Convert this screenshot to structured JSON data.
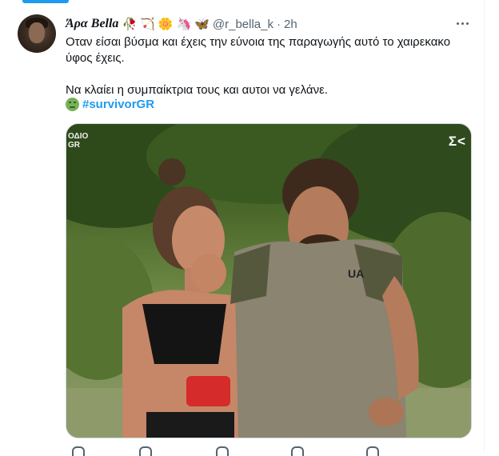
{
  "tweet": {
    "author_name": "Άρα Bella",
    "author_emojis": [
      "🥀",
      "🏹",
      "🌼",
      "🦄",
      "🦋"
    ],
    "handle": "@r_bella_k",
    "separator": "·",
    "time": "2h",
    "text_line1": "Οταν είσαι βύσμα και έχεις την εύνοια της παραγωγής αυτό το χαιρεκακο",
    "text_line2": "ύφος έχεις.",
    "text_line3": "Να κλαίει η συμπαίκτρια τους και αυτοι να γελάνε.",
    "hashtag": "#survivorGR",
    "hashtag_emoji": "sick-face-emoji",
    "more_icon": "more-horizontal-icon"
  },
  "media": {
    "watermark_left_line1": "ΟΔΙΟ",
    "watermark_left_line2": "GR",
    "watermark_right": "Σ<",
    "description_colors": {
      "foliage": "#4d6a2c",
      "shirt": "#8a8471",
      "skin": "#c68a6a"
    }
  },
  "colors": {
    "accent": "#1d9bf0",
    "muted": "#536471",
    "text": "#0f1419",
    "border": "#cfd9de"
  }
}
